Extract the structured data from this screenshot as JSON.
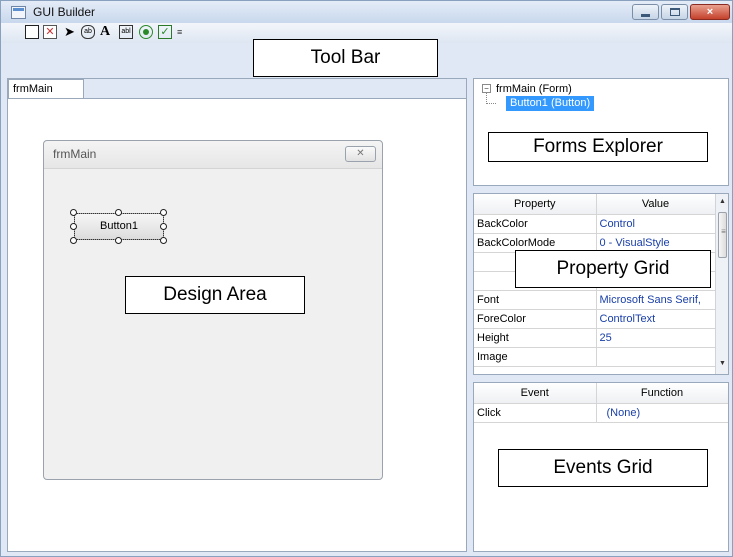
{
  "window": {
    "title": "GUI Builder",
    "close_glyph": "×"
  },
  "toolbar": {
    "tools": [
      "new-form",
      "delete-form",
      "pointer",
      "button",
      "label",
      "textbox",
      "option",
      "checkbox",
      "listbox"
    ],
    "button_glyph": "ab",
    "label_glyph": "A",
    "textbox_glyph": "abl",
    "checkbox_glyph": "✓",
    "delete_glyph": "✕",
    "pointer_glyph": "➤",
    "list_glyph": "≡"
  },
  "callouts": {
    "toolbar": "Tool Bar",
    "design": "Design Area",
    "forms": "Forms Explorer",
    "property": "Property Grid",
    "events": "Events Grid"
  },
  "design": {
    "tab_label": "frmMain",
    "form_title": "frmMain",
    "form_close_glyph": "✕",
    "button_label": "Button1"
  },
  "forms_explorer": {
    "toggle_glyph": "−",
    "root": "frmMain (Form)",
    "child": "Button1 (Button)"
  },
  "property_grid": {
    "headers": [
      "Property",
      "Value"
    ],
    "rows": [
      [
        "BackColor",
        "Control"
      ],
      [
        "BackColorMode",
        "0 - VisualStyle"
      ],
      [
        "",
        ""
      ],
      [
        "",
        ""
      ],
      [
        "Font",
        "Microsoft Sans Serif,"
      ],
      [
        "ForeColor",
        "ControlText"
      ],
      [
        "Height",
        "25"
      ],
      [
        "Image",
        ""
      ]
    ],
    "scroll_up": "▲",
    "scroll_down": "▼"
  },
  "events_grid": {
    "headers": [
      "Event",
      "Function"
    ],
    "rows": [
      [
        "Click",
        "(None)"
      ]
    ]
  },
  "colors": {
    "selection": "#3399ff",
    "value_text": "#1a3fa8",
    "chrome": "#dfe8f4"
  }
}
